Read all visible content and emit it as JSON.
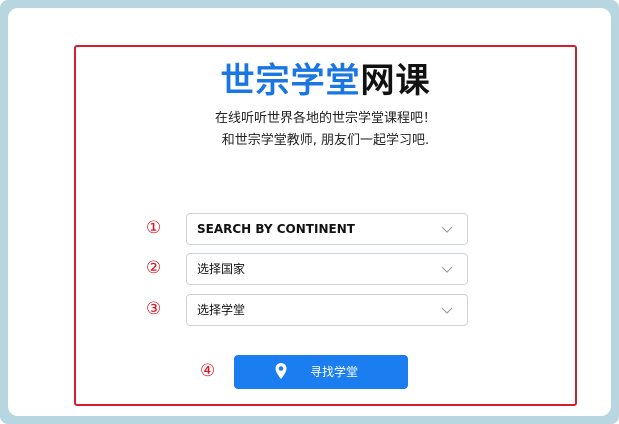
{
  "header": {
    "title_part1": "世宗学堂",
    "title_part2": "网课",
    "subtitle_line1": "在线听听世界各地的世宗学堂课程吧！",
    "subtitle_line2": "和世宗学堂教师, 朋友们一起学习吧."
  },
  "steps": {
    "step1_marker": "①",
    "step2_marker": "②",
    "step3_marker": "③",
    "step4_marker": "④"
  },
  "form": {
    "continent_select": "SEARCH BY CONTINENT",
    "country_select": "选择国家",
    "institute_select": "选择学堂",
    "find_button": "寻找学堂"
  },
  "colors": {
    "brand_blue": "#1976e2",
    "button_blue": "#1a7ef0",
    "annotation_red": "#d21f2f",
    "frame_teal": "#b8d6df"
  },
  "icons": {
    "select_arrow": "chevron-down-icon",
    "button_icon": "map-pin-icon"
  }
}
